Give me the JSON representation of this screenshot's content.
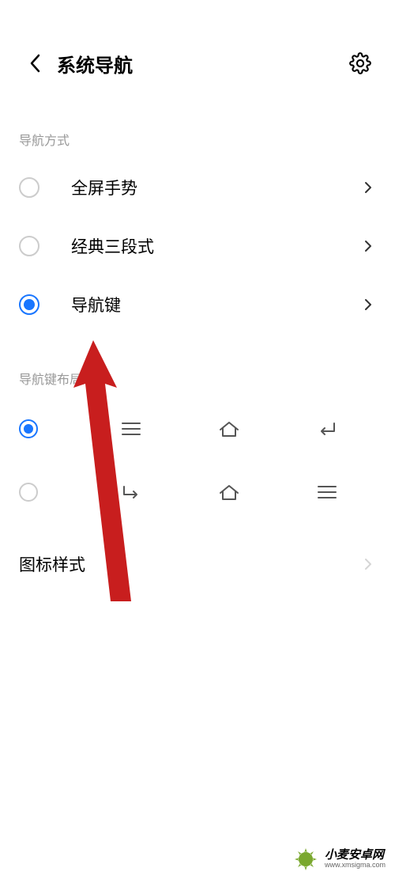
{
  "header": {
    "title": "系统导航"
  },
  "sections": {
    "nav_method": {
      "label": "导航方式",
      "options": [
        {
          "label": "全屏手势",
          "selected": false
        },
        {
          "label": "经典三段式",
          "selected": false
        },
        {
          "label": "导航键",
          "selected": true
        }
      ]
    },
    "nav_layout": {
      "label": "导航键布局",
      "options": [
        {
          "selected": true,
          "order": [
            "menu",
            "home",
            "back"
          ]
        },
        {
          "selected": false,
          "order": [
            "back",
            "home",
            "menu"
          ]
        }
      ]
    },
    "icon_style": {
      "label": "图标样式"
    }
  },
  "watermark": {
    "name": "小麦安卓网",
    "url": "www.xmsigma.com"
  }
}
